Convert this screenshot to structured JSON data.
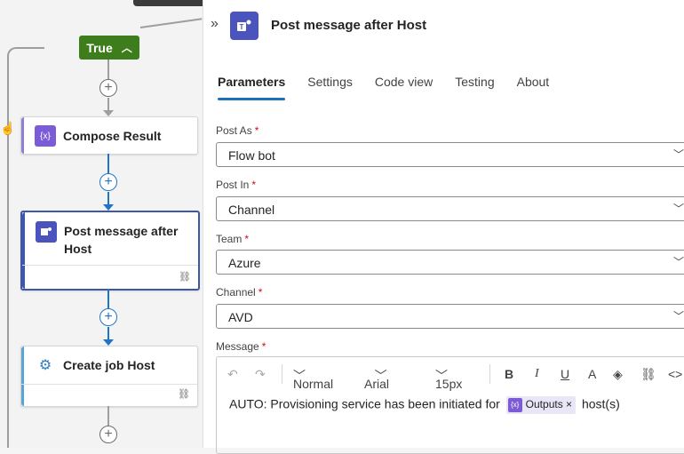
{
  "canvas": {
    "condition_badge": "True",
    "cards": [
      {
        "title": "Compose Result"
      },
      {
        "title_line1": "Post message after",
        "title_line2": "Host"
      },
      {
        "title": "Create job Host"
      }
    ],
    "compose_icon_text": "{𝑥}"
  },
  "panel": {
    "title": "Post message after Host",
    "tabs": [
      "Parameters",
      "Settings",
      "Code view",
      "Testing",
      "About"
    ],
    "active_tab": "Parameters",
    "fields": [
      {
        "label": "Post As",
        "value": "Flow bot"
      },
      {
        "label": "Post In",
        "value": "Channel"
      },
      {
        "label": "Team",
        "value": "Azure"
      },
      {
        "label": "Channel",
        "value": "AVD"
      }
    ],
    "message_label": "Message",
    "required_mark": "*",
    "toolbar": {
      "style": "Normal",
      "font": "Arial",
      "size": "15px"
    },
    "message": {
      "text_before": "AUTO: Provisioning service has been initiated for",
      "token": "Outputs",
      "text_after": "host(s)"
    }
  },
  "colors": {
    "true_badge": "#3d7d1c",
    "teams": "#4b53bc",
    "connector_active": "#1f74c5",
    "tab_underline": "#1f6fbf"
  }
}
